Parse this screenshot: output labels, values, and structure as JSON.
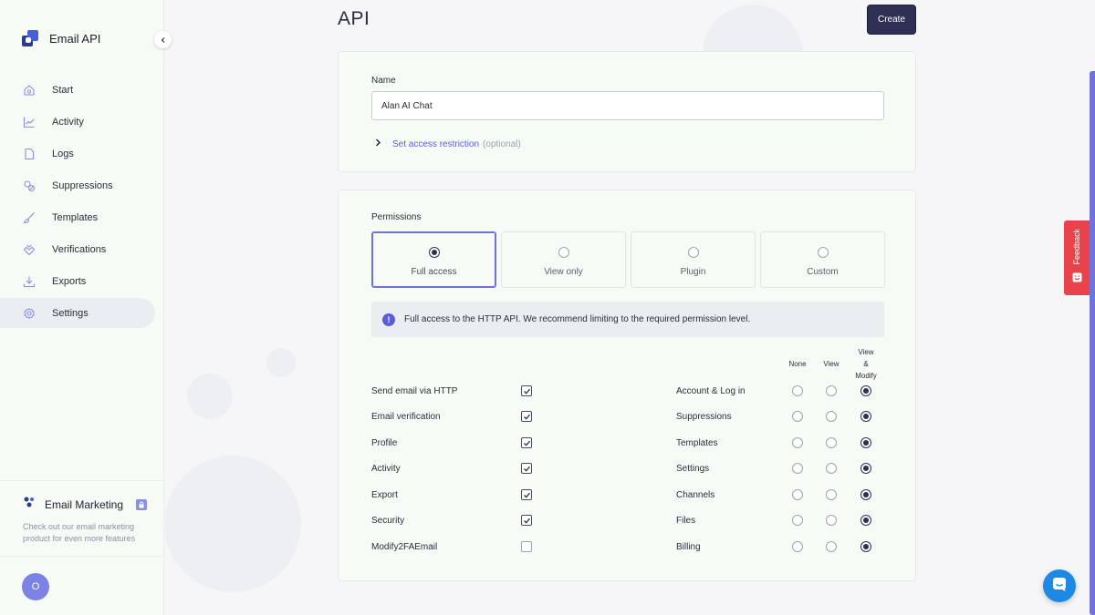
{
  "app": {
    "name": "Email API"
  },
  "sidebar": {
    "items": [
      {
        "label": "Start",
        "icon": "home-icon"
      },
      {
        "label": "Activity",
        "icon": "chart-line-icon"
      },
      {
        "label": "Logs",
        "icon": "file-icon"
      },
      {
        "label": "Suppressions",
        "icon": "suppression-icon"
      },
      {
        "label": "Templates",
        "icon": "brush-icon"
      },
      {
        "label": "Verifications",
        "icon": "verify-icon"
      },
      {
        "label": "Exports",
        "icon": "download-icon"
      },
      {
        "label": "Settings",
        "icon": "gear-icon",
        "active": true
      }
    ],
    "promo": {
      "title": "Email Marketing",
      "text": "Check out our email marketing product for even more features"
    },
    "user_initial": "O"
  },
  "header": {
    "title": "API",
    "create_label": "Create"
  },
  "name_card": {
    "label": "Name",
    "value": "Alan AI Chat",
    "restriction_link": "Set access restriction",
    "restriction_optional": "(optional)"
  },
  "permissions": {
    "label": "Permissions",
    "options": [
      {
        "label": "Full access",
        "selected": true
      },
      {
        "label": "View only",
        "selected": false
      },
      {
        "label": "Plugin",
        "selected": false
      },
      {
        "label": "Custom",
        "selected": false
      }
    ],
    "info": "Full access to the HTTP API. We recommend limiting to the required permission level.",
    "columns": {
      "none": "None",
      "view": "View",
      "modify_1": "View",
      "modify_2": "&",
      "modify_3": "Modify"
    },
    "left": [
      {
        "label": "Send email via HTTP",
        "checked": true
      },
      {
        "label": "Email verification",
        "checked": true
      },
      {
        "label": "Profile",
        "checked": true
      },
      {
        "label": "Activity",
        "checked": true
      },
      {
        "label": "Export",
        "checked": true
      },
      {
        "label": "Security",
        "checked": true
      },
      {
        "label": "Modify2FAEmail",
        "checked": false
      }
    ],
    "right": [
      {
        "label": "Account & Log in",
        "level": "modify"
      },
      {
        "label": "Suppressions",
        "level": "modify"
      },
      {
        "label": "Templates",
        "level": "modify"
      },
      {
        "label": "Settings",
        "level": "modify"
      },
      {
        "label": "Channels",
        "level": "modify"
      },
      {
        "label": "Files",
        "level": "modify"
      },
      {
        "label": "Billing",
        "level": "modify"
      }
    ]
  },
  "feedback": {
    "label": "Feedback"
  },
  "colors": {
    "accent": "#5a5fd6",
    "primary_button": "#2e2f52",
    "feedback": "#e8434a",
    "chat": "#1e88e5"
  }
}
